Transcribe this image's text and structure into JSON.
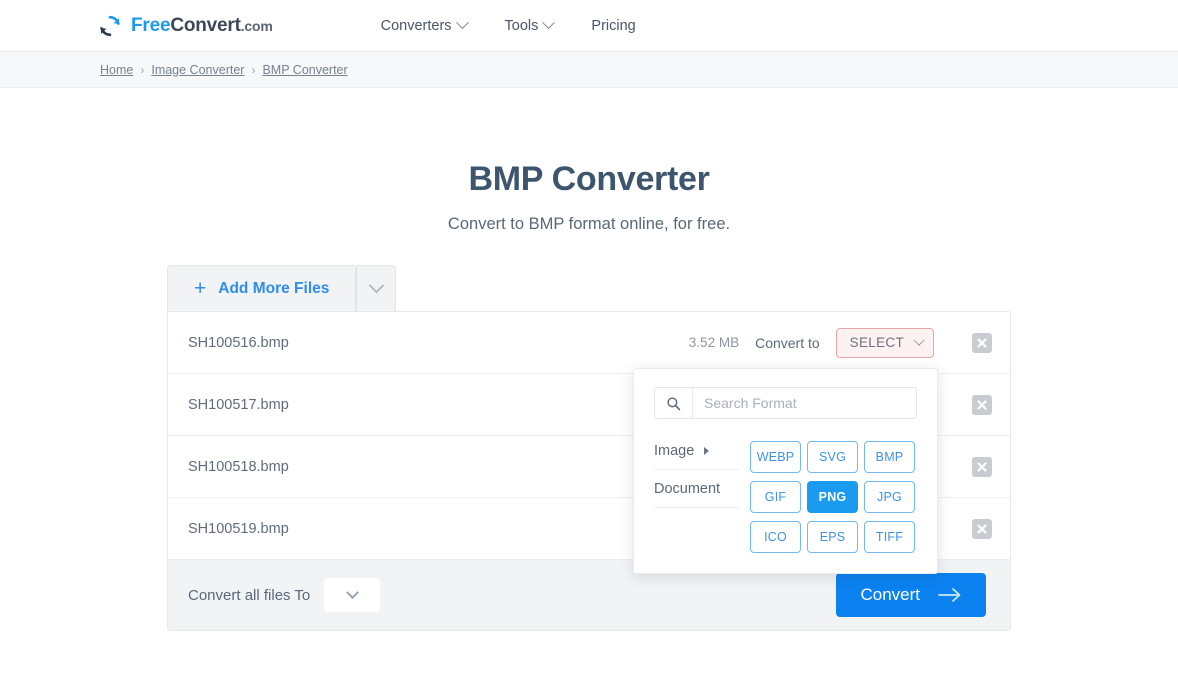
{
  "header": {
    "logo": {
      "icon": "refresh-circular-arrows-icon",
      "free": "Free",
      "convert": "Convert",
      "dotcom": ".com"
    },
    "nav": [
      {
        "label": "Converters",
        "has_caret": true
      },
      {
        "label": "Tools",
        "has_caret": true
      },
      {
        "label": "Pricing",
        "has_caret": false
      }
    ]
  },
  "breadcrumb": {
    "separator": "›",
    "items": [
      "Home",
      "Image Converter",
      "BMP Converter"
    ]
  },
  "page": {
    "title": "BMP Converter",
    "subtitle": "Convert to BMP format online, for free."
  },
  "tabs": {
    "add_more_files": "Add More Files",
    "plus_icon": "plus-icon",
    "caret_icon": "chevron-down-icon"
  },
  "files": {
    "convert_to_label": "Convert to",
    "select_label": "SELECT",
    "remove_icon": "close-x-icon",
    "rows": [
      {
        "name": "SH100516.bmp",
        "size": "3.52 MB",
        "show_meta": true
      },
      {
        "name": "SH100517.bmp",
        "size": "",
        "show_meta": false
      },
      {
        "name": "SH100518.bmp",
        "size": "",
        "show_meta": false
      },
      {
        "name": "SH100519.bmp",
        "size": "",
        "show_meta": false
      }
    ]
  },
  "footer": {
    "convert_all_label": "Convert all files To",
    "convert_all_caret": "chevron-down-icon",
    "convert_button": "Convert",
    "convert_arrow_icon": "arrow-right-icon"
  },
  "format_dropdown": {
    "search_icon": "search-icon",
    "search_placeholder": "Search Format",
    "search_value": "",
    "categories": [
      {
        "label": "Image",
        "arrow": true
      },
      {
        "label": "Document",
        "arrow": false
      }
    ],
    "formats": [
      {
        "label": "WEBP",
        "selected": false
      },
      {
        "label": "SVG",
        "selected": false
      },
      {
        "label": "BMP",
        "selected": false
      },
      {
        "label": "GIF",
        "selected": false
      },
      {
        "label": "PNG",
        "selected": true
      },
      {
        "label": "JPG",
        "selected": false
      },
      {
        "label": "ICO",
        "selected": false
      },
      {
        "label": "EPS",
        "selected": false
      },
      {
        "label": "TIFF",
        "selected": false
      }
    ]
  },
  "colors": {
    "brand_blue": "#1a9bf0",
    "convert_blue": "#0b82f0",
    "title_slate": "#3d566e",
    "select_border": "#e8a6a6",
    "select_bg": "#fdf1f1"
  }
}
